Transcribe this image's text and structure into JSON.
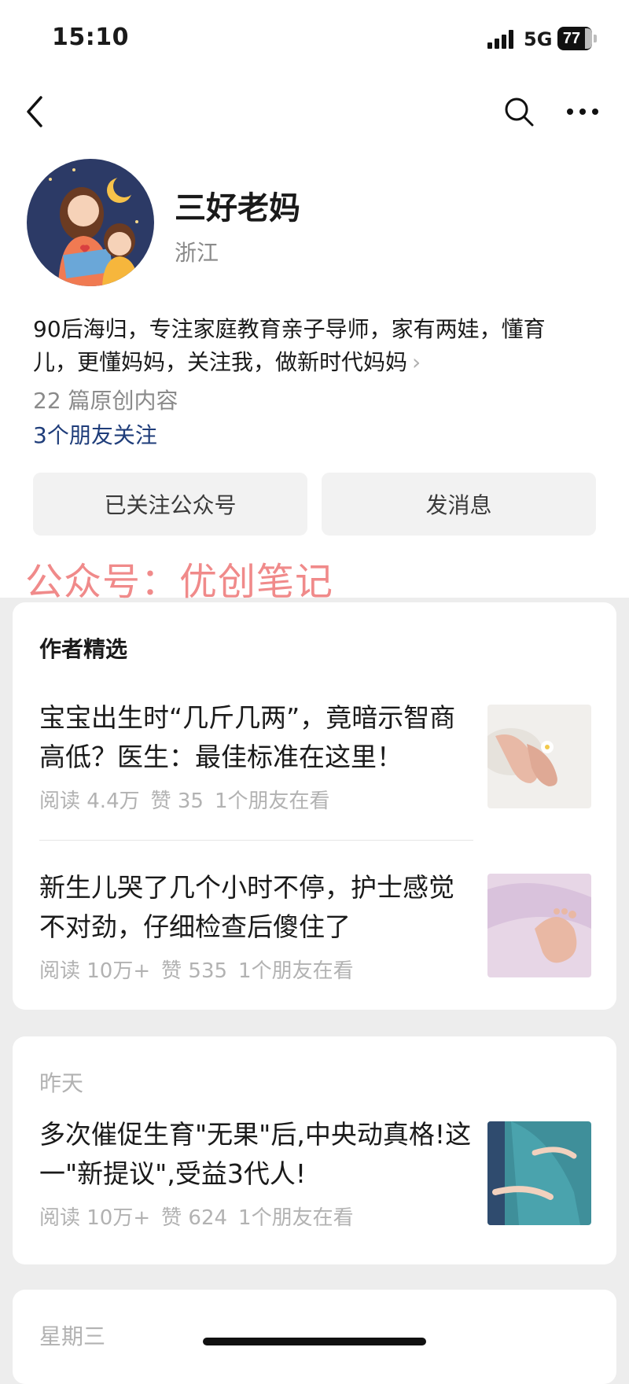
{
  "status_bar": {
    "time": "15:10",
    "network": "5G",
    "battery": "77"
  },
  "account": {
    "name": "三好老妈",
    "region": "浙江",
    "bio": "90后海归，专注家庭教育亲子导师，家有两娃，懂育儿，更懂妈妈，关注我，做新时代妈妈",
    "original_count": "22 篇原创内容",
    "friends_following": "3个朋友关注"
  },
  "buttons": {
    "follow": "已关注公众号",
    "message": "发消息"
  },
  "watermark": "公众号：优创笔记",
  "sections": [
    {
      "label": "作者精选",
      "articles": [
        {
          "title": "宝宝出生时“几斤几两”，竟暗示智商高低？医生：最佳标准在这里！",
          "reads": "阅读 4.4万",
          "likes": "赞 35",
          "friends": "1个朋友在看"
        },
        {
          "title": "新生儿哭了几个小时不停，护士感觉不对劲，仔细检查后傻住了",
          "reads": "阅读 10万+",
          "likes": "赞 535",
          "friends": "1个朋友在看"
        }
      ]
    },
    {
      "label": "昨天",
      "articles": [
        {
          "title": "多次催促生育\"无果\"后,中央动真格!这一\"新提议\",受益3代人!",
          "reads": "阅读 10万+",
          "likes": "赞 624",
          "friends": "1个朋友在看"
        }
      ]
    },
    {
      "label": "星期三",
      "articles": []
    }
  ]
}
